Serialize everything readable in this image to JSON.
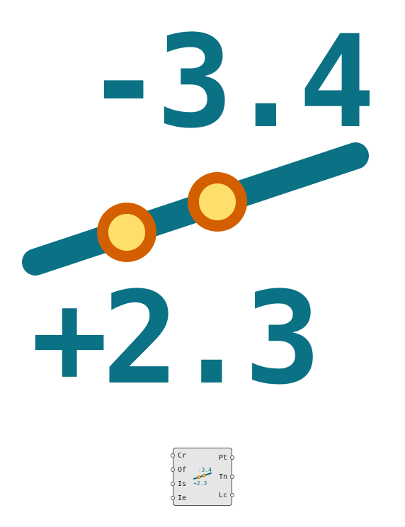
{
  "icon": {
    "top_value": "-3.4",
    "bottom_value": "+2.3",
    "colors": {
      "line": "#0b7185",
      "point_ring": "#d35f00",
      "point_fill": "#ffdf6b"
    }
  },
  "component": {
    "inputs": [
      "Cr",
      "Of",
      "Is",
      "Ie"
    ],
    "outputs": [
      "Pt",
      "Tn",
      "Lc"
    ],
    "mini_top_value": "-3.4",
    "mini_bottom_value": "+2.3"
  }
}
